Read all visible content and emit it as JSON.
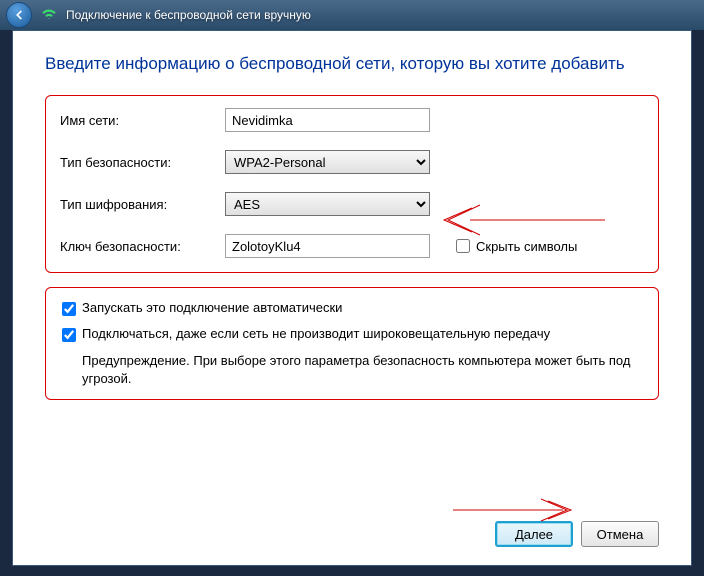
{
  "titlebar": {
    "text": "Подключение к беспроводной сети вручную"
  },
  "heading": "Введите информацию о беспроводной сети, которую вы хотите добавить",
  "form": {
    "network_name_label": "Имя сети:",
    "network_name_value": "Nevidimka",
    "security_type_label": "Тип безопасности:",
    "security_type_value": "WPA2-Personal",
    "encryption_label": "Тип шифрования:",
    "encryption_value": "AES",
    "security_key_label": "Ключ безопасности:",
    "security_key_value": "ZolotoyKlu4",
    "hide_chars_label": "Скрыть символы"
  },
  "options": {
    "auto_connect_label": "Запускать это подключение автоматически",
    "connect_hidden_label": "Подключаться, даже если сеть не производит широковещательную передачу",
    "warning_text": "Предупреждение. При выборе этого параметра безопасность компьютера может быть под угрозой."
  },
  "buttons": {
    "next": "Далее",
    "cancel": "Отмена"
  },
  "annotation_color": "#d00000"
}
